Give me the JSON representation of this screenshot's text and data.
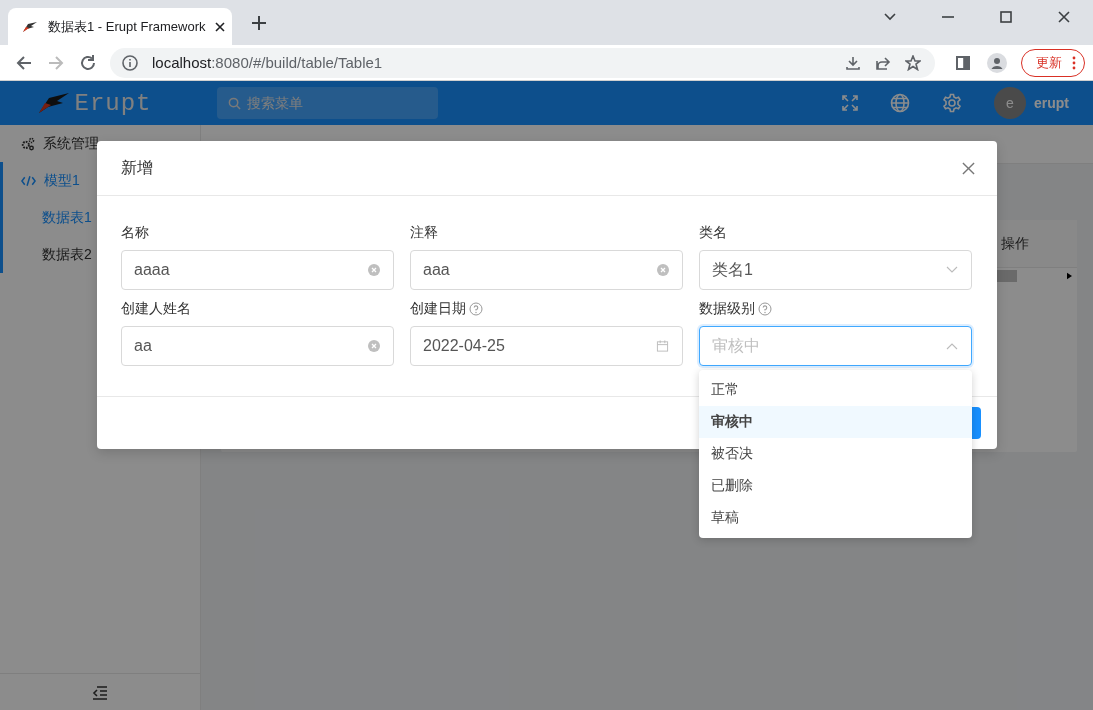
{
  "browser": {
    "tab_title": "数据表1 - Erupt Framework",
    "url_host": "localhost",
    "url_path": ":8080/#/build/table/Table1",
    "update_button": "更新"
  },
  "header": {
    "logo_text": "Erupt",
    "search": {
      "placeholder": "搜索菜单"
    },
    "user": {
      "avatar_letter": "e",
      "name": "erupt"
    }
  },
  "sidebar": {
    "items": [
      {
        "label": "系统管理",
        "expanded": false
      },
      {
        "label": "模型1",
        "expanded": true,
        "children": [
          {
            "label": "数据表1",
            "selected": true
          },
          {
            "label": "数据表2",
            "selected": false
          }
        ]
      }
    ]
  },
  "table": {
    "columns": [
      "操作"
    ]
  },
  "modal": {
    "title": "新增",
    "fields": [
      {
        "label": "名称",
        "kind": "text",
        "value": "aaaa",
        "help": false
      },
      {
        "label": "注释",
        "kind": "text",
        "value": "aaa",
        "help": false
      },
      {
        "label": "类名",
        "kind": "select",
        "value": "类名1",
        "help": false,
        "open": false
      },
      {
        "label": "创建人姓名",
        "kind": "text",
        "value": "aa",
        "help": false
      },
      {
        "label": "创建日期",
        "kind": "date",
        "value": "2022-04-25",
        "help": true
      },
      {
        "label": "数据级别",
        "kind": "select",
        "placeholder": "审核中",
        "help": true,
        "open": true,
        "options": [
          {
            "label": "正常",
            "selected": false
          },
          {
            "label": "审核中",
            "selected": true
          },
          {
            "label": "被否决",
            "selected": false
          },
          {
            "label": "已删除",
            "selected": false
          },
          {
            "label": "草稿",
            "selected": false
          }
        ]
      }
    ]
  }
}
